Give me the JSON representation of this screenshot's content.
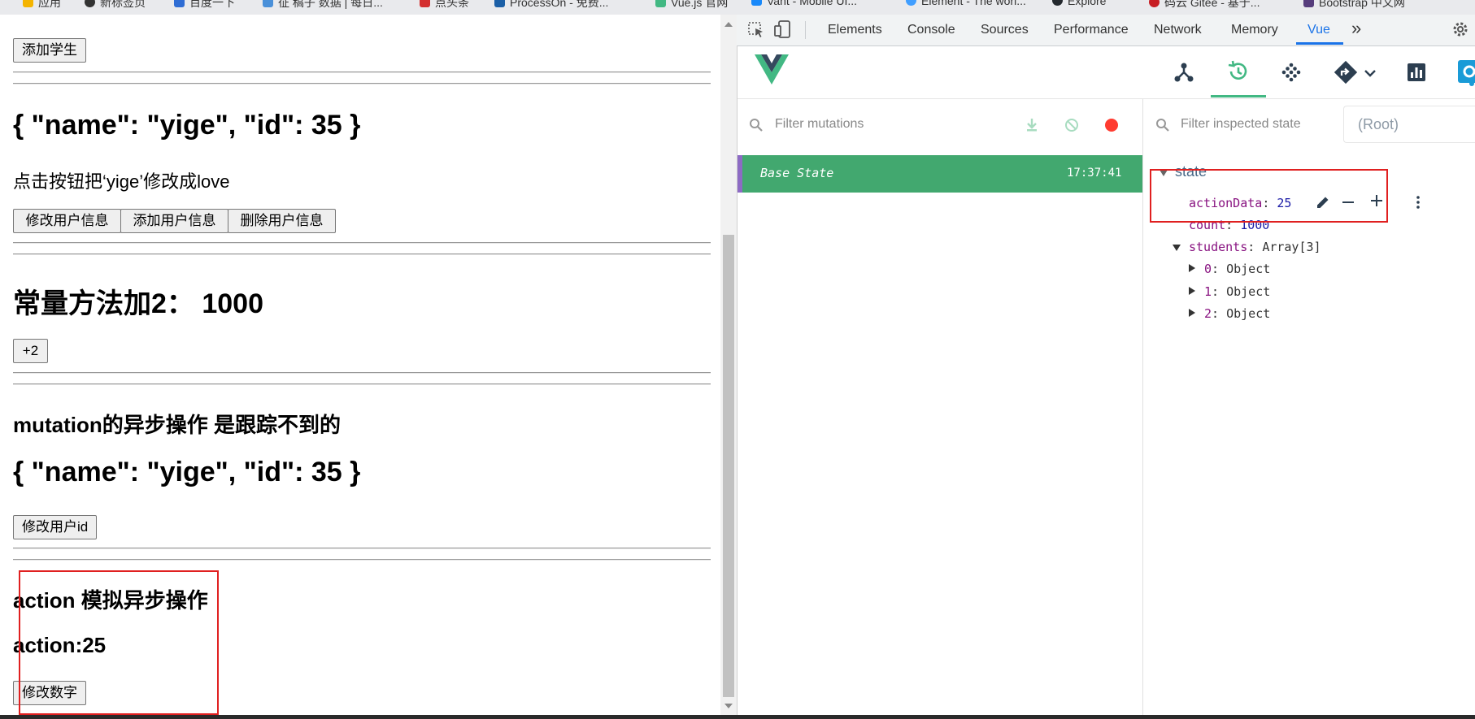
{
  "bookmarks": [
    "应用",
    "新标签页",
    "百度一下",
    "征 稿子 数据 | 每日...",
    "点头条",
    "ProcessOn - 免费...",
    "Vue.js 官网",
    "Vant - Mobile UI...",
    "Element - The worl...",
    "Explore",
    "码云 Gitee - 基于...",
    "Bootstrap 中文网"
  ],
  "page": {
    "add_student_button": "添加学生",
    "user_json_1": "{ \"name\": \"yige\", \"id\": 35 }",
    "instruction": "点击按钮把‘yige’修改成love",
    "modify_user_button": "修改用户信息",
    "add_user_button": "添加用户信息",
    "delete_user_button": "删除用户信息",
    "constant_heading": "常量方法加2： 1000",
    "plus_two_button": "+2",
    "mutation_heading": "mutation的异步操作 是跟踪不到的",
    "user_json_2": "{ \"name\": \"yige\", \"id\": 35 }",
    "modify_id_button": "修改用户id",
    "action_heading": "action 模拟异步操作",
    "action_value": "action:25",
    "modify_number_button": "修改数字"
  },
  "devtools": {
    "tabs": [
      "Elements",
      "Console",
      "Sources",
      "Performance",
      "Network",
      "Memory",
      "Vue"
    ],
    "active_tab": "Vue",
    "more_tabs_glyph": "»",
    "filter_mutations_placeholder": "Filter mutations",
    "filter_state_placeholder": "Filter inspected state",
    "root_select": "(Root)",
    "mutations": [
      {
        "label": "Base State",
        "time": "17:37:41"
      }
    ],
    "state": {
      "root_label": "state",
      "action_data": {
        "key": "actionData",
        "value": "25"
      },
      "count": {
        "key": "count",
        "value": "1000"
      },
      "students": {
        "key": "students",
        "type": "Array[3]",
        "items": [
          {
            "key": "0",
            "type": "Object"
          },
          {
            "key": "1",
            "type": "Object"
          },
          {
            "key": "2",
            "type": "Object"
          }
        ]
      }
    }
  },
  "colors": {
    "vue_green": "#42b883",
    "base_state_bg": "#42a86f",
    "highlight_red": "#e02020",
    "record_red": "#ff3b30"
  }
}
